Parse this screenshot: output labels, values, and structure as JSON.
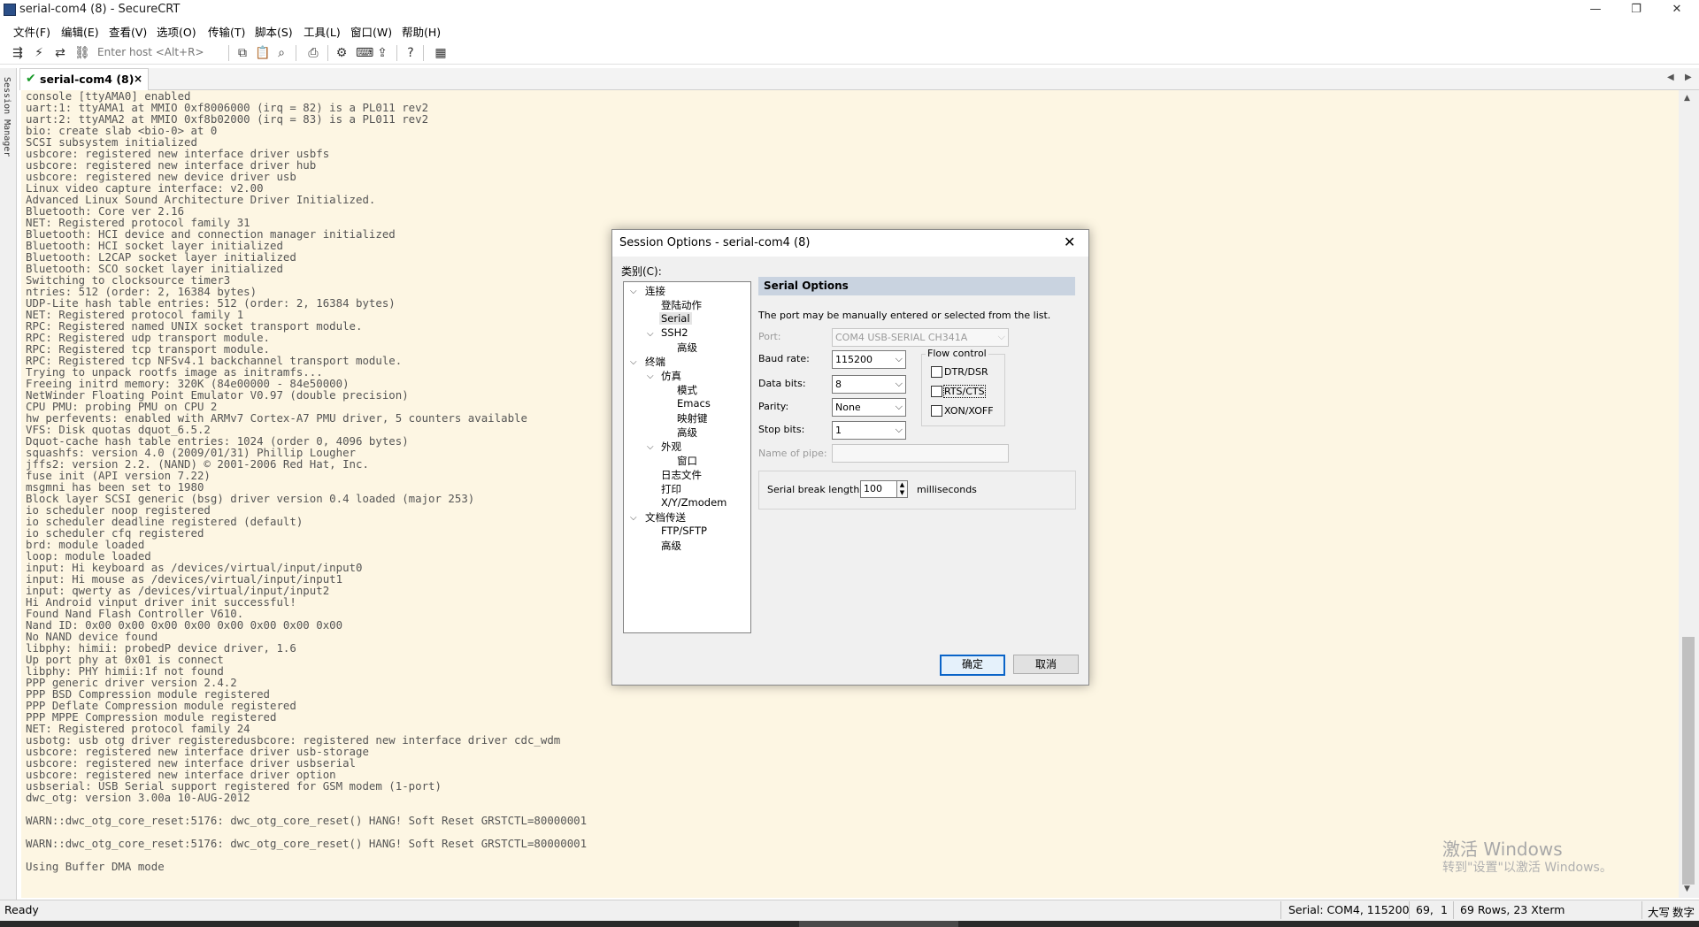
{
  "window": {
    "title": "serial-com4 (8) - SecureCRT",
    "controls": {
      "minimize": "—",
      "maximize": "❐",
      "close": "✕"
    }
  },
  "menu": [
    "文件(F)",
    "编辑(E)",
    "查看(V)",
    "选项(O)",
    "传输(T)",
    "脚本(S)",
    "工具(L)",
    "窗口(W)",
    "帮助(H)"
  ],
  "toolbar": {
    "host_placeholder": "Enter host <Alt+R>"
  },
  "tab": {
    "label": "serial-com4 (8)",
    "close": "×",
    "connected_icon": "check-icon"
  },
  "session_manager_label": "Session Manager",
  "terminal": {
    "lines": [
      "console [ttyAMA0] enabled",
      "uart:1: ttyAMA1 at MMIO 0xf8006000 (irq = 82) is a PL011 rev2",
      "uart:2: ttyAMA2 at MMIO 0xf8b02000 (irq = 83) is a PL011 rev2",
      "bio: create slab <bio-0> at 0",
      "SCSI subsystem initialized",
      "usbcore: registered new interface driver usbfs",
      "usbcore: registered new interface driver hub",
      "usbcore: registered new device driver usb",
      "Linux video capture interface: v2.00",
      "Advanced Linux Sound Architecture Driver Initialized.",
      "Bluetooth: Core ver 2.16",
      "NET: Registered protocol family 31",
      "Bluetooth: HCI device and connection manager initialized",
      "Bluetooth: HCI socket layer initialized",
      "Bluetooth: L2CAP socket layer initialized",
      "Bluetooth: SCO socket layer initialized",
      "Switching to clocksource timer3",
      "ntries: 512 (order: 2, 16384 bytes)",
      "UDP-Lite hash table entries: 512 (order: 2, 16384 bytes)",
      "NET: Registered protocol family 1",
      "RPC: Registered named UNIX socket transport module.",
      "RPC: Registered udp transport module.",
      "RPC: Registered tcp transport module.",
      "RPC: Registered tcp NFSv4.1 backchannel transport module.",
      "Trying to unpack rootfs image as initramfs...",
      "Freeing initrd memory: 320K (84e00000 - 84e50000)",
      "NetWinder Floating Point Emulator V0.97 (double precision)",
      "CPU PMU: probing PMU on CPU 2",
      "hw perfevents: enabled with ARMv7 Cortex-A7 PMU driver, 5 counters available",
      "VFS: Disk quotas dquot_6.5.2",
      "Dquot-cache hash table entries: 1024 (order 0, 4096 bytes)",
      "squashfs: version 4.0 (2009/01/31) Phillip Lougher",
      "jffs2: version 2.2. (NAND) © 2001-2006 Red Hat, Inc.",
      "fuse init (API version 7.22)",
      "msgmni has been set to 1980",
      "Block layer SCSI generic (bsg) driver version 0.4 loaded (major 253)",
      "io scheduler noop registered",
      "io scheduler deadline registered (default)",
      "io scheduler cfq registered",
      "brd: module loaded",
      "loop: module loaded",
      "input: Hi keyboard as /devices/virtual/input/input0",
      "input: Hi mouse as /devices/virtual/input/input1",
      "input: qwerty as /devices/virtual/input/input2",
      "Hi Android vinput driver init successful!",
      "Found Nand Flash Controller V610.",
      "Nand ID: 0x00 0x00 0x00 0x00 0x00 0x00 0x00 0x00",
      "No NAND device found",
      "libphy: himii: probedP device driver, 1.6",
      "Up port phy at 0x01 is connect",
      "libphy: PHY himii:1f not found",
      "PPP generic driver version 2.4.2",
      "PPP BSD Compression module registered",
      "PPP Deflate Compression module registered",
      "PPP MPPE Compression module registered",
      "NET: Registered protocol family 24",
      "usbotg: usb otg driver registeredusbcore: registered new interface driver cdc_wdm",
      "usbcore: registered new interface driver usb-storage",
      "usbcore: registered new interface driver usbserial",
      "usbcore: registered new interface driver option",
      "usbserial: USB Serial support registered for GSM modem (1-port)",
      "dwc_otg: version 3.00a 10-AUG-2012",
      "",
      "WARN::dwc_otg_core_reset:5176: dwc_otg_core_reset() HANG! Soft Reset GRSTCTL=80000001",
      "",
      "WARN::dwc_otg_core_reset:5176: dwc_otg_core_reset() HANG! Soft Reset GRSTCTL=80000001",
      "",
      "Using Buffer DMA mode"
    ]
  },
  "statusbar": {
    "ready": "Ready",
    "serial": "Serial: COM4, 115200",
    "pos_row": "69,",
    "pos_col": "1",
    "size": "69 Rows, 23 Xterm",
    "caps": "大写",
    "num": "数字"
  },
  "watermark": {
    "line1": "激活 Windows",
    "line2": "转到\"设置\"以激活 Windows。"
  },
  "dialog": {
    "title": "Session Options - serial-com4 (8)",
    "category_label": "类别(C):",
    "tree": {
      "connection": "连接",
      "login_actions": "登陆动作",
      "serial": "Serial",
      "ssh2": "SSH2",
      "ssh2_advanced": "高级",
      "terminal": "终端",
      "emulation": "仿真",
      "modes": "模式",
      "emacs": "Emacs",
      "mapped_keys": "映射键",
      "emulation_advanced": "高级",
      "appearance": "外观",
      "window": "窗口",
      "log_file": "日志文件",
      "printing": "打印",
      "xyzmodem": "X/Y/Zmodem",
      "file_transfer": "文档传送",
      "ftp_sftp": "FTP/SFTP",
      "ft_advanced": "高级"
    },
    "panel_title": "Serial Options",
    "port_note": "The port may be manually entered or selected from the list.",
    "port": {
      "label": "Port:",
      "value": "COM4 USB-SERIAL CH341A"
    },
    "baud": {
      "label": "Baud rate:",
      "value": "115200"
    },
    "data_bits": {
      "label": "Data bits:",
      "value": "8"
    },
    "parity": {
      "label": "Parity:",
      "value": "None"
    },
    "stop_bits": {
      "label": "Stop bits:",
      "value": "1"
    },
    "pipe_label": "Name of pipe:",
    "flow": {
      "title": "Flow control",
      "dtr": "DTR/DSR",
      "rts": "RTS/CTS",
      "xon": "XON/XOFF"
    },
    "break": {
      "label": "Serial break length:",
      "value": "100",
      "unit": "milliseconds"
    },
    "ok": "确定",
    "cancel": "取消"
  }
}
